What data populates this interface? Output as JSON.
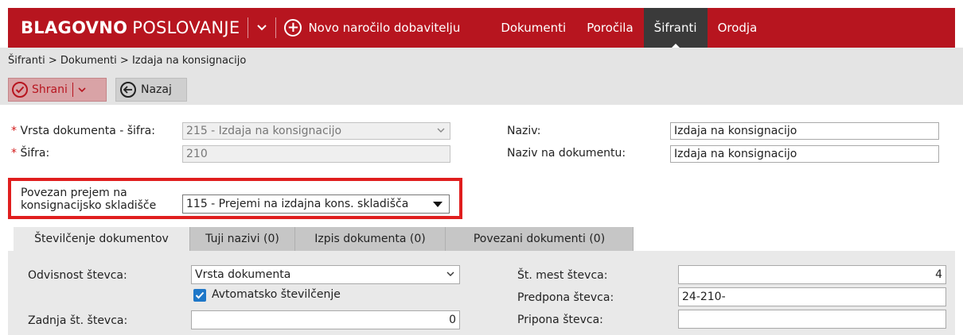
{
  "app": {
    "brand_bold": "BLAGOVNO",
    "brand_light": "POSLOVANJE",
    "new_order_label": "Novo naročilo dobavitelju"
  },
  "nav": {
    "items": [
      {
        "label": "Dokumenti"
      },
      {
        "label": "Poročila"
      },
      {
        "label": "Šifranti"
      },
      {
        "label": "Orodja"
      }
    ],
    "active": "Šifranti"
  },
  "breadcrumb": "Šifranti > Dokumenti > Izdaja na konsignacijo",
  "toolbar": {
    "save_label": "Shrani",
    "back_label": "Nazaj"
  },
  "form": {
    "doc_type_label": "Vrsta dokumenta - šifra:",
    "doc_type_value": "215 - Izdaja na konsignacijo",
    "code_label": "Šifra:",
    "code_value": "210",
    "name_label": "Naziv:",
    "name_value": "Izdaja na konsignacijo",
    "doc_name_label": "Naziv na dokumentu:",
    "doc_name_value": "Izdaja na konsignacijo",
    "linked_receipt_label_1": "Povezan prejem na",
    "linked_receipt_label_2": "konsignacijsko skladišče",
    "linked_receipt_value": "115 - Prejemi na izdajna kons. skladišča"
  },
  "tabs": [
    {
      "label": "Številčenje dokumentov"
    },
    {
      "label": "Tuji nazivi (0)"
    },
    {
      "label": "Izpis dokumenta (0)"
    },
    {
      "label": "Povezani dokumenti (0)"
    }
  ],
  "numbering": {
    "counter_dependency_label": "Odvisnost števca:",
    "counter_dependency_value": "Vrsta dokumenta",
    "auto_numbering_label": "Avtomatsko številčenje",
    "auto_numbering_checked": true,
    "last_counter_label": "Zadnja št. števca:",
    "last_counter_value": "0",
    "counter_places_label": "Št. mest števca:",
    "counter_places_value": "4",
    "prefix_label": "Predpona števca:",
    "prefix_value": "24-210-",
    "suffix_label": "Pripona števca:",
    "suffix_value": ""
  },
  "colors": {
    "brand_red": "#b7151f",
    "active_nav": "#3a3a3a",
    "checkbox_blue": "#1e77c8",
    "highlight_red": "#e01e1e"
  }
}
